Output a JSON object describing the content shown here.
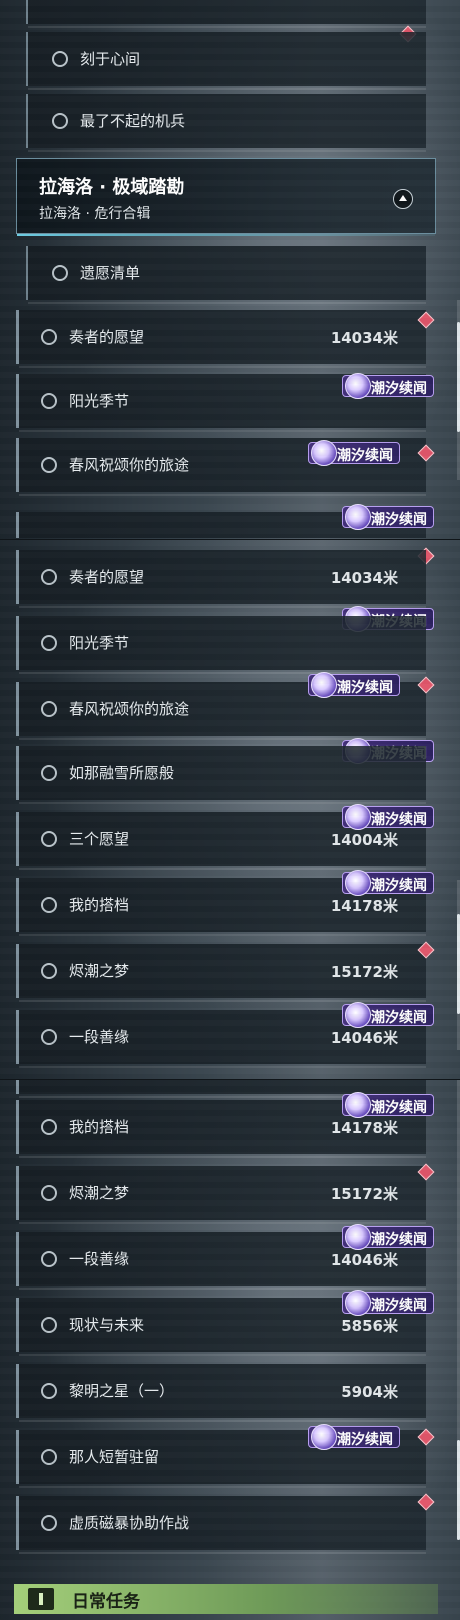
{
  "colors": {
    "accent_diamond": "#e0566a",
    "badge_purple": "#43307a",
    "header_border": "#6a8c9c",
    "daily_green": "#a4cf7a"
  },
  "section": {
    "title": "拉海洛 · 极域踏勘",
    "subtitle": "拉海洛 · 危行合辑",
    "toggle_icon": "chevron-up-icon"
  },
  "badge_text": "潮汐续闻",
  "panel1": {
    "items": [
      {
        "label": "刻于心间"
      },
      {
        "label": "最了不起的机兵"
      },
      {
        "label": "遗愿清单"
      },
      {
        "label": "奏者的愿望",
        "distance": "14034米"
      },
      {
        "label": "阳光季节"
      },
      {
        "label": "春风祝颂你的旅途"
      }
    ]
  },
  "panel2": {
    "items": [
      {
        "label": "奏者的愿望",
        "distance": "14034米"
      },
      {
        "label": "阳光季节"
      },
      {
        "label": "春风祝颂你的旅途"
      },
      {
        "label": "如那融雪所愿般"
      },
      {
        "label": "三个愿望",
        "distance": "14004米"
      },
      {
        "label": "我的搭档",
        "distance": "14178米"
      },
      {
        "label": "烬潮之梦",
        "distance": "15172米"
      },
      {
        "label": "一段善缘",
        "distance": "14046米"
      }
    ]
  },
  "panel3": {
    "items": [
      {
        "label": "我的搭档",
        "distance": "14178米"
      },
      {
        "label": "烬潮之梦",
        "distance": "15172米"
      },
      {
        "label": "一段善缘",
        "distance": "14046米"
      },
      {
        "label": "现状与未来",
        "distance": "5856米"
      },
      {
        "label": "黎明之星（一）",
        "distance": "5904米"
      },
      {
        "label": "那人短暂驻留"
      },
      {
        "label": "虚质磁暴协助作战"
      }
    ]
  },
  "daily": {
    "label": "日常任务",
    "icon": "quest-book-icon"
  }
}
